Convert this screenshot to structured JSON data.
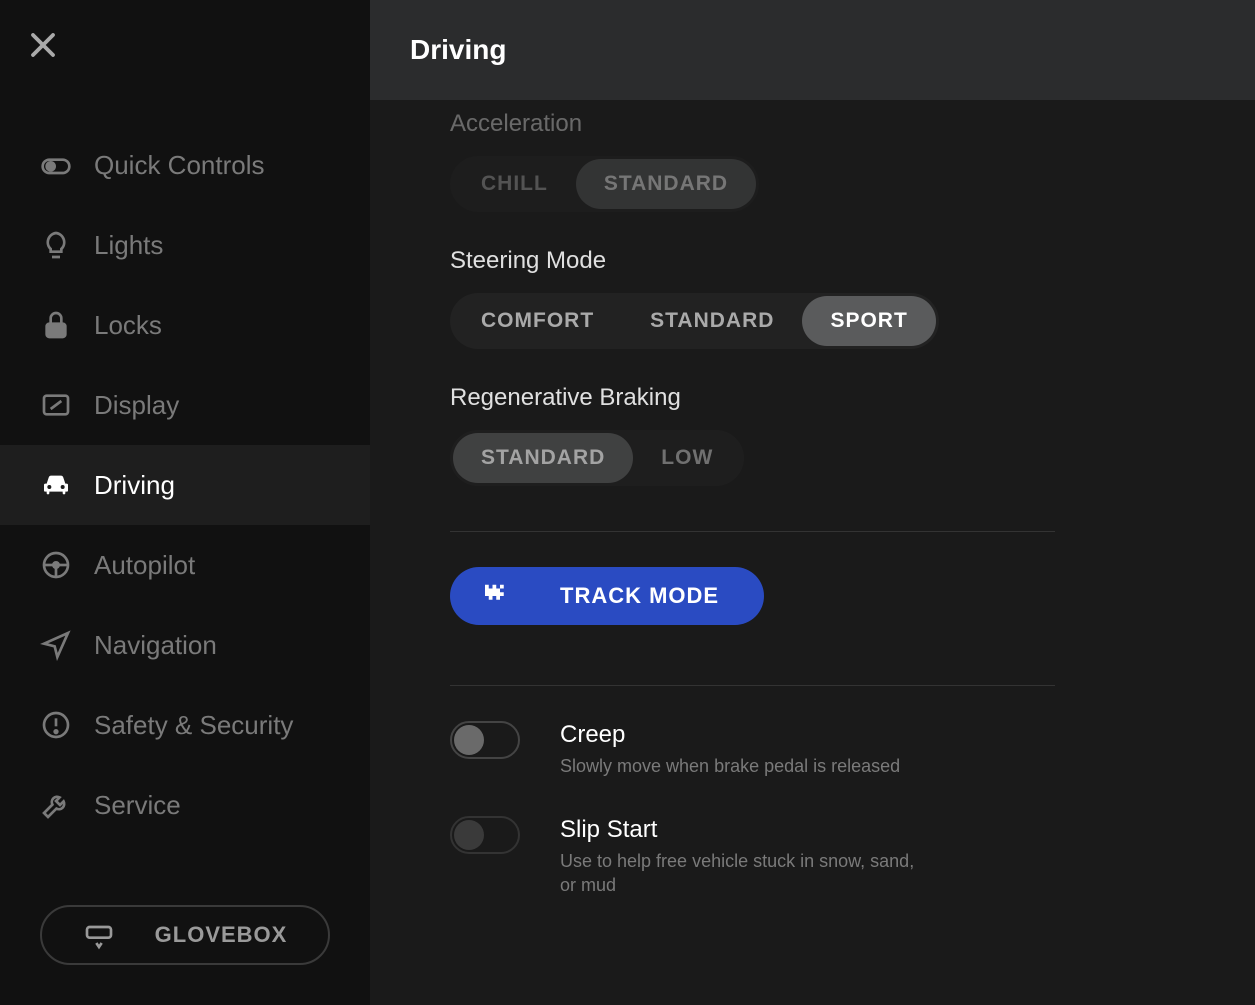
{
  "header": {
    "title": "Driving"
  },
  "sidebar": {
    "items": [
      {
        "label": "Quick Controls",
        "icon": "toggle-icon"
      },
      {
        "label": "Lights",
        "icon": "bulb-icon"
      },
      {
        "label": "Locks",
        "icon": "lock-icon"
      },
      {
        "label": "Display",
        "icon": "display-icon"
      },
      {
        "label": "Driving",
        "icon": "car-icon"
      },
      {
        "label": "Autopilot",
        "icon": "steering-icon"
      },
      {
        "label": "Navigation",
        "icon": "nav-icon"
      },
      {
        "label": "Safety & Security",
        "icon": "alert-icon"
      },
      {
        "label": "Service",
        "icon": "wrench-icon"
      }
    ],
    "glovebox_label": "GLOVEBOX"
  },
  "acceleration": {
    "label": "Acceleration",
    "options": [
      "CHILL",
      "STANDARD"
    ],
    "selected": "STANDARD"
  },
  "steering": {
    "label": "Steering Mode",
    "options": [
      "COMFORT",
      "STANDARD",
      "SPORT"
    ],
    "selected": "SPORT"
  },
  "regen": {
    "label": "Regenerative Braking",
    "options": [
      "STANDARD",
      "LOW"
    ],
    "selected": "STANDARD"
  },
  "track_mode": {
    "label": "TRACK MODE"
  },
  "toggles": {
    "creep": {
      "title": "Creep",
      "desc": "Slowly move when brake pedal is released",
      "on": false
    },
    "slip_start": {
      "title": "Slip Start",
      "desc": "Use to help free vehicle stuck in snow, sand, or mud",
      "on": false
    }
  }
}
